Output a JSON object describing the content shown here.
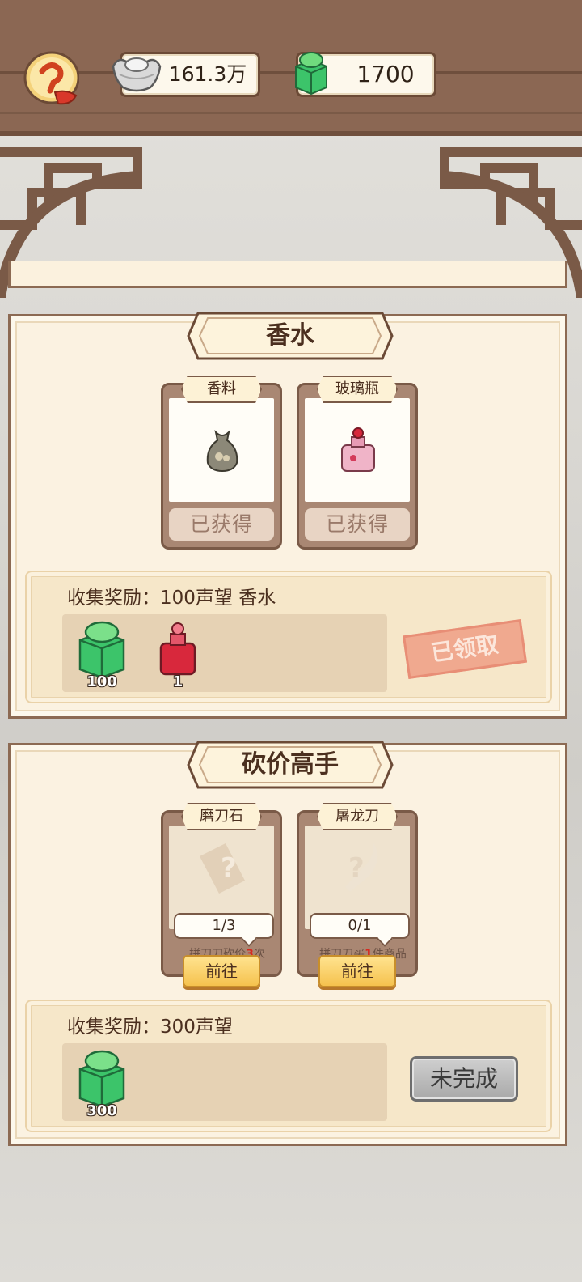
{
  "header": {
    "silver_amount": "161.3万",
    "jade_amount": "1700"
  },
  "collections": [
    {
      "title": "香水",
      "items": [
        {
          "name": "香料",
          "status": "已获得"
        },
        {
          "name": "玻璃瓶",
          "status": "已获得"
        }
      ],
      "reward_label": "收集奖励：100声望 香水",
      "rewards": [
        {
          "icon": "jade-icon",
          "count": "100"
        },
        {
          "icon": "perfume-bottle-icon",
          "count": "1"
        }
      ],
      "state": "已领取"
    },
    {
      "title": "砍价高手",
      "items": [
        {
          "name": "磨刀石",
          "progress": "1/3",
          "hint_pre": "拼刀刀砍价",
          "hint_num": "3",
          "hint_post": "次",
          "action": "前往"
        },
        {
          "name": "屠龙刀",
          "progress": "0/1",
          "hint_pre": "拼刀刀买",
          "hint_num": "1",
          "hint_post": "件商品",
          "action": "前往"
        }
      ],
      "reward_label": "收集奖励：300声望",
      "rewards": [
        {
          "icon": "jade-icon",
          "count": "300"
        }
      ],
      "state": "未完成"
    }
  ],
  "colors": {
    "wood": "#8b6753",
    "panel": "#fbf2e1",
    "claimed_stamp": "#f0a68c",
    "go_button": "#f5c24e"
  }
}
